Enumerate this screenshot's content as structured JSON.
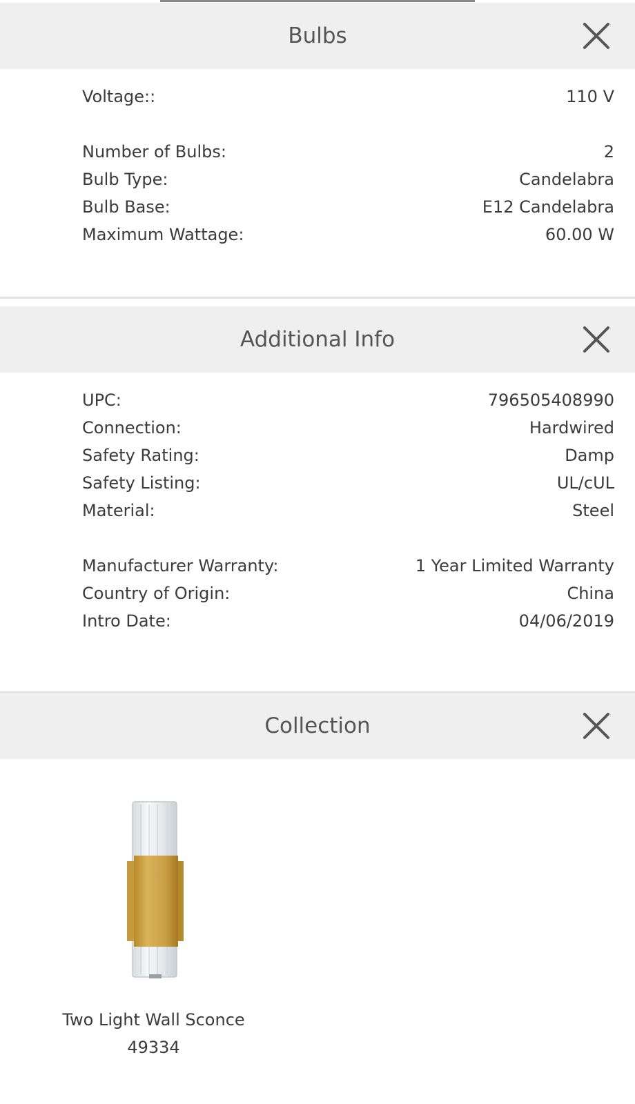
{
  "bulbs": {
    "title": "Bulbs",
    "close_icon": "close-icon",
    "rows": [
      {
        "label": "Voltage::",
        "value": "110 V"
      },
      {
        "label": "Number of Bulbs:",
        "value": "2"
      },
      {
        "label": "Bulb Type:",
        "value": "Candelabra"
      },
      {
        "label": "Bulb Base:",
        "value": "E12 Candelabra"
      },
      {
        "label": "Maximum Wattage:",
        "value": "60.00 W"
      }
    ]
  },
  "additional_info": {
    "title": "Additional Info",
    "close_icon": "close-icon",
    "rows": [
      {
        "label": "UPC:",
        "value": "796505408990"
      },
      {
        "label": "Connection:",
        "value": "Hardwired"
      },
      {
        "label": "Safety Rating:",
        "value": "Damp"
      },
      {
        "label": "Safety Listing:",
        "value": "UL/cUL"
      },
      {
        "label": "Material:",
        "value": "Steel"
      },
      {
        "label": "Manufacturer Warranty:",
        "value": "1 Year Limited Warranty"
      },
      {
        "label": "Country of Origin:",
        "value": "China"
      },
      {
        "label": "Intro Date:",
        "value": "04/06/2019"
      }
    ]
  },
  "collection": {
    "title": "Collection",
    "close_icon": "close-icon",
    "items": [
      {
        "name": "Two Light Wall Sconce",
        "sku": "49334",
        "image_icon": "wall-sconce-image"
      }
    ]
  },
  "colors": {
    "header_bg": "#efefef",
    "text": "#3b3b3b",
    "title_text": "#555555",
    "brass": "#c9a040"
  }
}
